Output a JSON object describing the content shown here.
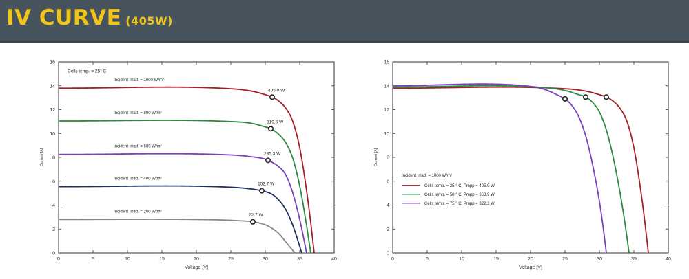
{
  "header": {
    "title": "IV CURVE",
    "subtitle": "(405W)"
  },
  "colors": {
    "header_bg": "#46535c",
    "title": "#f0c419"
  },
  "chart_data": [
    {
      "type": "line",
      "title": "",
      "xlabel": "Voltage [V]",
      "ylabel": "Current [A]",
      "xlim": [
        0,
        40
      ],
      "ylim": [
        0,
        16
      ],
      "xticks": [
        "0",
        "5",
        "10",
        "15",
        "20",
        "25",
        "30",
        "35",
        "40"
      ],
      "yticks": [
        "0",
        "2",
        "4",
        "6",
        "8",
        "10",
        "12",
        "14",
        "16"
      ],
      "grid": false,
      "legend": "none",
      "annotation": "Cells temp. = 25° C",
      "series": [
        {
          "name": "Incident Irrad. = 1000 W/m²",
          "color": "#a51e24",
          "isc": 13.8,
          "voc": 37.1,
          "vmp": 31.0,
          "imp": 13.05,
          "mpp_label": "405.0 W",
          "x": [
            0,
            25,
            28,
            30,
            31,
            32,
            33,
            34,
            35,
            35.8,
            36.5,
            37.1
          ],
          "y": [
            13.8,
            13.75,
            13.55,
            13.25,
            13.05,
            12.7,
            12.1,
            11.0,
            8.8,
            6.0,
            3.0,
            0
          ]
        },
        {
          "name": "Incident Irrad. = 800 W/m²",
          "color": "#2b8a3e",
          "isc": 11.05,
          "voc": 36.6,
          "vmp": 30.8,
          "imp": 10.4,
          "mpp_label": "319.5 W",
          "x": [
            0,
            25,
            28,
            30,
            30.8,
            32,
            33,
            34,
            35,
            35.8,
            36.6
          ],
          "y": [
            11.05,
            11.0,
            10.85,
            10.55,
            10.4,
            9.9,
            9.2,
            7.9,
            5.6,
            3.0,
            0
          ]
        },
        {
          "name": "Incident Irrad. = 600 W/m²",
          "color": "#7b3fbf",
          "isc": 8.25,
          "voc": 36.0,
          "vmp": 30.4,
          "imp": 7.75,
          "mpp_label": "235.3 W",
          "x": [
            0,
            25,
            28,
            30,
            30.4,
            32,
            33,
            34,
            35,
            36.0
          ],
          "y": [
            8.25,
            8.2,
            8.05,
            7.85,
            7.75,
            7.2,
            6.5,
            5.0,
            2.8,
            0
          ]
        },
        {
          "name": "Incident Irrad. = 400 W/m²",
          "color": "#202f5c",
          "isc": 5.55,
          "voc": 35.3,
          "vmp": 29.5,
          "imp": 5.2,
          "mpp_label": "152.7 W",
          "x": [
            0,
            25,
            28,
            29.5,
            31,
            32,
            33,
            34,
            35.3
          ],
          "y": [
            5.55,
            5.5,
            5.35,
            5.2,
            4.9,
            4.4,
            3.6,
            2.3,
            0
          ]
        },
        {
          "name": "Incident Irrad. = 200 W/m²",
          "color": "#888888",
          "isc": 2.8,
          "voc": 34.3,
          "vmp": 28.2,
          "imp": 2.6,
          "mpp_label": "72.7 W",
          "x": [
            0,
            22,
            26,
            28.2,
            30,
            31,
            32,
            33,
            34.3
          ],
          "y": [
            2.8,
            2.78,
            2.7,
            2.6,
            2.35,
            2.05,
            1.6,
            0.9,
            0
          ]
        }
      ]
    },
    {
      "type": "line",
      "title": "",
      "xlabel": "Voltage [V]",
      "ylabel": "Current [A]",
      "xlim": [
        0,
        40
      ],
      "ylim": [
        0,
        16
      ],
      "xticks": [
        "0",
        "5",
        "10",
        "15",
        "20",
        "25",
        "30",
        "35",
        "40"
      ],
      "yticks": [
        "0",
        "2",
        "4",
        "6",
        "8",
        "10",
        "12",
        "14",
        "16"
      ],
      "grid": false,
      "legend": "center-left",
      "annotation": "Incident Irrad. = 1000 W/m²",
      "series": [
        {
          "name": "Cells temp. = 25 ° C,  Pmpp = 405.0 W",
          "color": "#a51e24",
          "isc": 13.8,
          "voc": 37.1,
          "vmp": 31.0,
          "imp": 13.05,
          "x": [
            0,
            25,
            28,
            30,
            31,
            32,
            33,
            34,
            35,
            35.8,
            36.5,
            37.1
          ],
          "y": [
            13.8,
            13.75,
            13.55,
            13.25,
            13.05,
            12.7,
            12.1,
            11.0,
            8.8,
            6.0,
            3.0,
            0
          ]
        },
        {
          "name": "Cells temp. = 50 ° C,  Pmpp = 363.9 W",
          "color": "#2b8a3e",
          "isc": 13.9,
          "voc": 34.3,
          "vmp": 28.0,
          "imp": 13.05,
          "x": [
            0,
            22,
            25,
            27,
            28,
            29,
            30,
            31,
            32,
            33,
            33.7,
            34.3
          ],
          "y": [
            13.9,
            13.85,
            13.6,
            13.25,
            13.05,
            12.6,
            11.8,
            10.3,
            8.0,
            5.0,
            2.5,
            0
          ]
        },
        {
          "name": "Cells temp. = 75 ° C,  Pmpp = 322.3 W",
          "color": "#7b3fbf",
          "isc": 14.0,
          "voc": 31.0,
          "vmp": 25.0,
          "imp": 12.9,
          "x": [
            0,
            20,
            22,
            24,
            25,
            26,
            27,
            28,
            29,
            30,
            30.5,
            31.0
          ],
          "y": [
            14.0,
            13.95,
            13.7,
            13.2,
            12.9,
            12.35,
            11.4,
            9.8,
            7.4,
            4.3,
            2.3,
            0
          ]
        }
      ]
    }
  ]
}
